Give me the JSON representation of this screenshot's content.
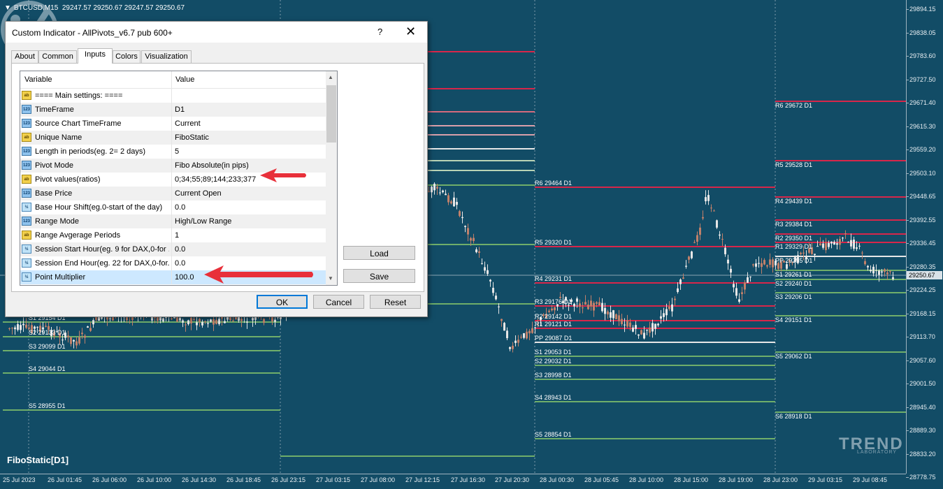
{
  "chart": {
    "symbol": "BTCUSD,M15",
    "ohlc": "29247.57 29250.67 29247.57 29250.67",
    "indicator_label": "FiboStatic[D1]",
    "current_price": "29250.67",
    "price_ticks": [
      "29894.15",
      "29838.05",
      "29783.60",
      "29727.50",
      "29671.40",
      "29615.30",
      "29559.20",
      "29503.10",
      "29448.65",
      "29392.55",
      "29336.45",
      "29280.35",
      "29224.25",
      "29168.15",
      "29113.70",
      "29057.60",
      "29001.50",
      "28945.40",
      "28889.30",
      "28833.20",
      "28778.75"
    ],
    "time_ticks": [
      "25 Jul 2023",
      "26 Jul 01:45",
      "26 Jul 06:00",
      "26 Jul 10:00",
      "26 Jul 14:30",
      "26 Jul 18:45",
      "26 Jul 23:15",
      "27 Jul 03:15",
      "27 Jul 08:00",
      "27 Jul 12:15",
      "27 Jul 16:30",
      "27 Jul 20:30",
      "28 Jul 00:30",
      "28 Jul 05:45",
      "28 Jul 10:00",
      "28 Jul 15:00",
      "28 Jul 19:00",
      "28 Jul 23:00",
      "29 Jul 03:15",
      "29 Jul 08:45"
    ],
    "levels_left": [
      {
        "label": "S1 29154 D1"
      },
      {
        "label": "S2 29133 D1"
      },
      {
        "label": "S3 29099 D1"
      },
      {
        "label": "S4 29044 D1"
      },
      {
        "label": "S5 28955 D1"
      }
    ],
    "levels_mid": [
      {
        "label": "R6 29464 D1"
      },
      {
        "label": "R5 29320 D1"
      },
      {
        "label": "R4 29231 D1"
      },
      {
        "label": "R3 29176 D1"
      },
      {
        "label": "R2 29142 D1"
      },
      {
        "label": "R1 29121 D1"
      },
      {
        "label": "PP 29087 D1"
      },
      {
        "label": "S1 29053 D1"
      },
      {
        "label": "S2 29032 D1"
      },
      {
        "label": "S3 28998 D1"
      },
      {
        "label": "S4 28943 D1"
      },
      {
        "label": "S5 28854 D1"
      }
    ],
    "levels_right": [
      {
        "label": "R6 29672 D1"
      },
      {
        "label": "R5 29528 D1"
      },
      {
        "label": "R4 29439 D1"
      },
      {
        "label": "R3 29384 D1"
      },
      {
        "label": "R2 29350 D1"
      },
      {
        "label": "R1 29329 D1"
      },
      {
        "label": "PP 29295 D1"
      },
      {
        "label": "S1 29261 D1"
      },
      {
        "label": "S2 29240 D1"
      },
      {
        "label": "S3 29206 D1"
      },
      {
        "label": "S4 29151 D1"
      },
      {
        "label": "S5 29062 D1"
      },
      {
        "label": "S6 28918 D1"
      }
    ],
    "watermark": {
      "brand": "TREND",
      "sub": "LABORATORY"
    },
    "colors": {
      "background": "#124c66",
      "resistance": "#d8264a",
      "pivot": "#e6e6e6",
      "support": "#6fae6a",
      "bull": "#e6e6e6",
      "bear": "#c0806a"
    }
  },
  "dialog": {
    "title": "Custom Indicator - AllPivots_v6.7 pub 600+",
    "help": "?",
    "close": "✕",
    "tabs": [
      "About",
      "Common",
      "Inputs",
      "Colors",
      "Visualization"
    ],
    "active_tab": "Inputs",
    "columns": {
      "variable": "Variable",
      "value": "Value"
    },
    "rows": [
      {
        "icon": "ab",
        "variable": "==== Main settings: ====",
        "value": ""
      },
      {
        "icon": "123",
        "variable": "TimeFrame",
        "value": "D1"
      },
      {
        "icon": "123",
        "variable": "Source Chart TimeFrame",
        "value": "Current"
      },
      {
        "icon": "ab",
        "variable": "Unique Name",
        "value": "FiboStatic"
      },
      {
        "icon": "123",
        "variable": "Length in periods(eg. 2= 2 days)",
        "value": "5"
      },
      {
        "icon": "123",
        "variable": "Pivot Mode",
        "value": "Fibo Absolute(in pips)"
      },
      {
        "icon": "ab",
        "variable": "Pivot values(ratios)",
        "value": "0;34;55;89;144;233;377"
      },
      {
        "icon": "123",
        "variable": "Base Price",
        "value": "Current Open"
      },
      {
        "icon": "v2",
        "variable": "Base Hour Shift(eg.0-start of the day)",
        "value": "0.0"
      },
      {
        "icon": "123",
        "variable": "Range Mode",
        "value": "High/Low Range"
      },
      {
        "icon": "ab",
        "variable": "Range Avgerage Periods",
        "value": "1"
      },
      {
        "icon": "v2",
        "variable": "Session Start Hour(eg. 9 for DAX,0-for ...",
        "value": "0.0"
      },
      {
        "icon": "v2",
        "variable": "Session End Hour(eg. 22 for DAX,0-for...",
        "value": "0.0"
      },
      {
        "icon": "v2",
        "variable": "Point Multiplier",
        "value": "100.0"
      }
    ],
    "buttons": {
      "load": "Load",
      "save": "Save",
      "ok": "OK",
      "cancel": "Cancel",
      "reset": "Reset"
    }
  }
}
